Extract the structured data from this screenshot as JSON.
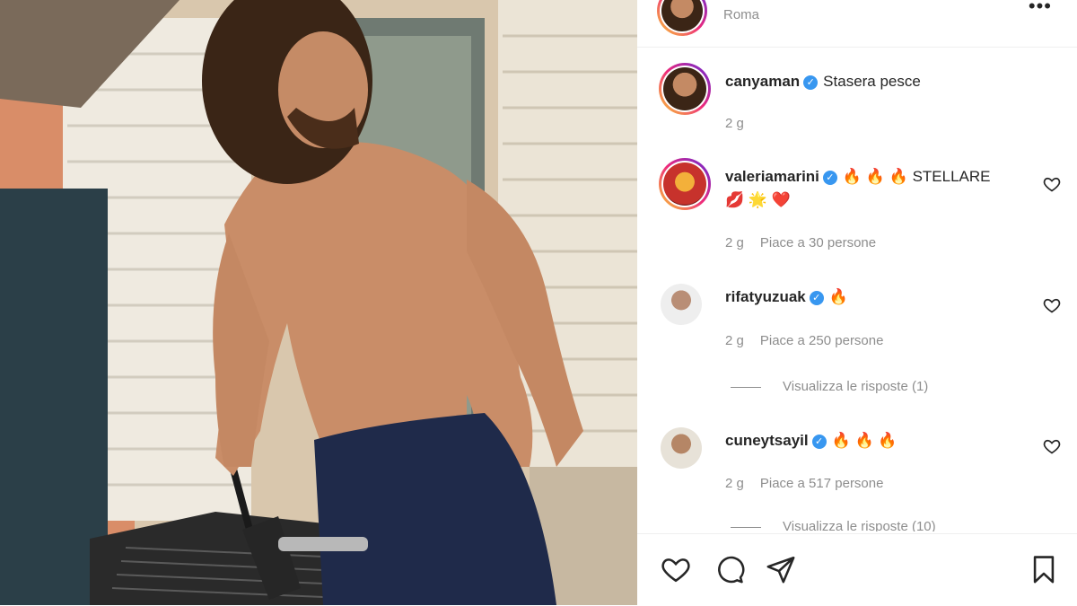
{
  "post": {
    "location": "Roma",
    "caption": {
      "username": "canyaman",
      "text": "Stasera pesce",
      "age": "2 g"
    }
  },
  "comments": [
    {
      "username": "valeriamarini",
      "text_line1": "🔥 🔥 🔥 STELLARE",
      "text_line2": "💋 🌟 ❤️",
      "age": "2 g",
      "likes": "Piace a 30 persone"
    },
    {
      "username": "rifatyuzuak",
      "text_line1": "🔥",
      "age": "2 g",
      "likes": "Piace a 250 persone",
      "replies": "Visualizza le risposte (1)"
    },
    {
      "username": "cuneytsayil",
      "text_line1": "🔥 🔥 🔥",
      "age": "2 g",
      "likes": "Piace a 517 persone",
      "replies": "Visualizza le risposte (10)"
    }
  ],
  "icons": {
    "verified": "verified-badge",
    "like": "heart-icon",
    "comment": "comment-icon",
    "share": "send-icon",
    "save": "bookmark-icon",
    "more": "more-options-icon"
  },
  "colors": {
    "text": "#262626",
    "muted": "#8e8e8e",
    "verified": "#3897f0"
  }
}
